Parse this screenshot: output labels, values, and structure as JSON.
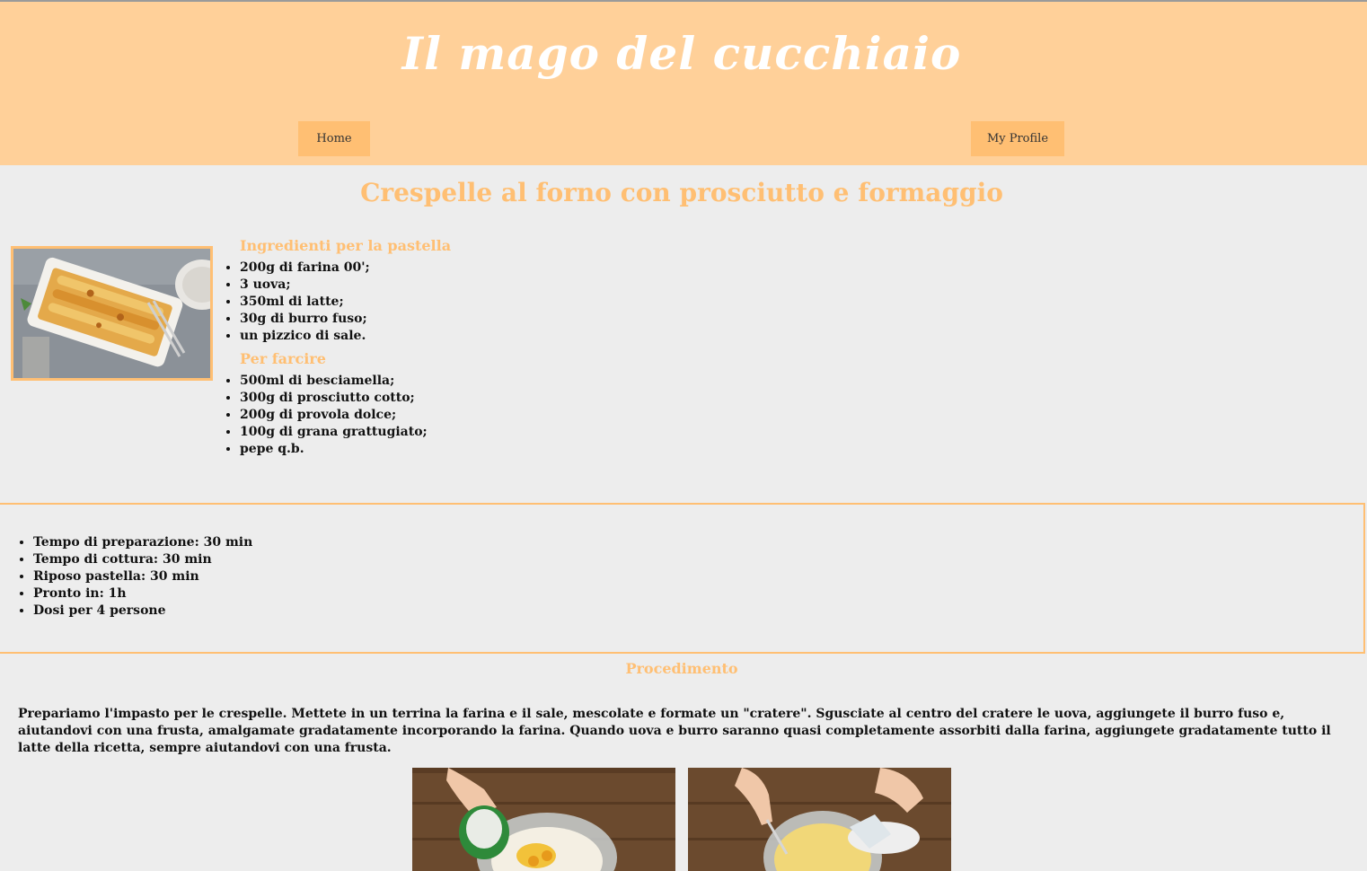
{
  "header": {
    "site_title": "Il mago del cucchiaio",
    "nav": {
      "home": "Home",
      "profile": "My Profile"
    },
    "bg_color": "#ffd099",
    "button_color": "#ffbf73"
  },
  "recipe": {
    "title": "Crespelle al forno con prosciutto e formaggio",
    "accent_color": "#ffbf73",
    "ingredients_pastella": {
      "heading": "Ingredienti per la pastella",
      "items": [
        "200g di farina 00';",
        "3 uova;",
        "350ml di latte;",
        "30g di burro fuso;",
        "un pizzico di sale."
      ]
    },
    "ingredients_farcire": {
      "heading": "Per farcire",
      "items": [
        "500ml di besciamella;",
        "300g di prosciutto cotto;",
        "200g di provola dolce;",
        "100g di grana grattugiato;",
        "pepe q.b."
      ]
    },
    "times": [
      "Tempo di preparazione: 30 min",
      "Tempo di cottura: 30 min",
      "Riposo pastella: 30 min",
      "Pronto in: 1h",
      "Dosi per 4 persone"
    ],
    "procedure": {
      "heading": "Procedimento",
      "text": "Prepariamo l'impasto per le crespelle. Mettete in un terrina la farina e il sale, mescolate e formate un \"cratere\". Sgusciate al centro del cratere le uova, aggiungete il burro fuso e, aiutandovi con una frusta, amalgamate gradatamente incorporando la farina. Quando uova e burro saranno quasi completamente assorbiti dalla farina, aggiungete gradatamente tutto il latte della ricetta, sempre aiutandovi con una frusta."
    }
  }
}
